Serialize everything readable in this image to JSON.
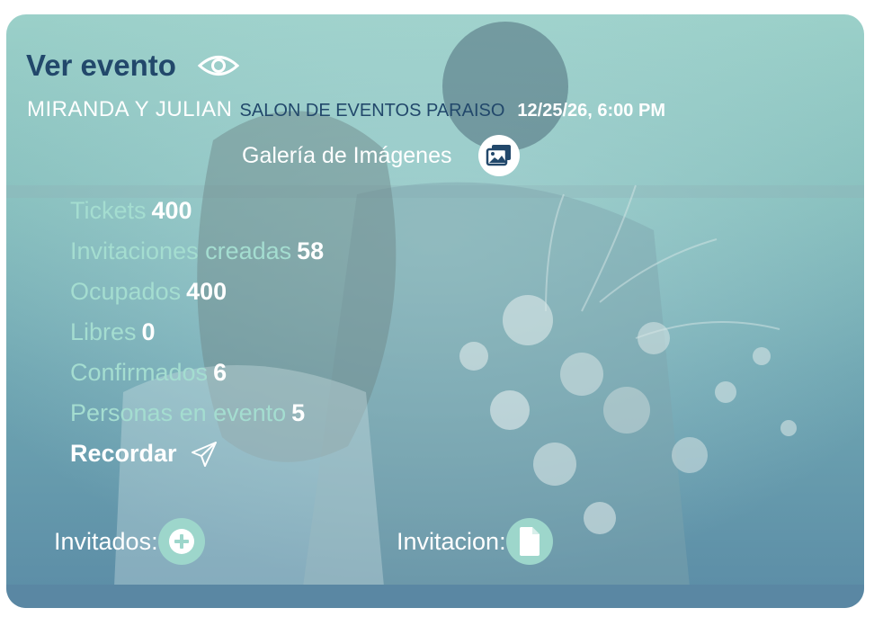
{
  "header": {
    "title": "Ver evento",
    "view_icon": "eye-icon"
  },
  "event": {
    "couple": "MIRANDA Y JULIAN",
    "venue": "SALON DE EVENTOS PARAISO",
    "datetime": "12/25/26, 6:00 PM"
  },
  "gallery": {
    "label": "Galería de Imágenes",
    "icon": "images-icon"
  },
  "stats": [
    {
      "label": "Tickets",
      "value": "400"
    },
    {
      "label": "Invitaciones creadas",
      "value": "58"
    },
    {
      "label": "Ocupados",
      "value": "400"
    },
    {
      "label": "Libres",
      "value": "0"
    },
    {
      "label": "Confirmados",
      "value": "6"
    },
    {
      "label": "Personas en evento",
      "value": "5"
    }
  ],
  "recordar": {
    "label": "Recordar",
    "icon": "send-icon"
  },
  "actions": {
    "invitados_label": "Invitados:",
    "invitados_icon": "plus-circle-icon",
    "invitacion_label": "Invitacion:",
    "invitacion_icon": "document-icon"
  },
  "colors": {
    "title": "#22486b",
    "stat_label": "#a4ddd0",
    "accent_button": "#9dd6cb",
    "card_top": "#9bd0c9",
    "card_bottom": "#5b8ca6"
  }
}
